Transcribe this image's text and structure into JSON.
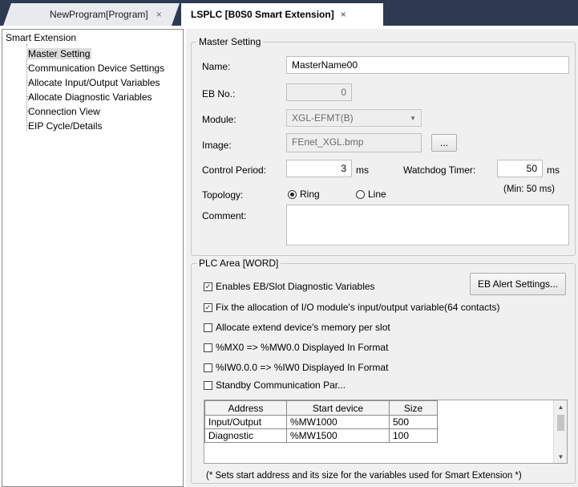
{
  "tabs": [
    {
      "label": "NewProgram[Program]",
      "close": "×"
    },
    {
      "label": "LSPLC [B0S0 Smart Extension]",
      "close": "×"
    }
  ],
  "tree": {
    "root": "Smart Extension",
    "items": [
      "Master Setting",
      "Communication Device Settings",
      "Allocate Input/Output Variables",
      "Allocate Diagnostic Variables",
      "Connection View",
      "EIP Cycle/Details"
    ]
  },
  "master": {
    "legend": "Master Setting",
    "name_label": "Name:",
    "name_value": "MasterName00",
    "eb_label": "EB No.:",
    "eb_value": "0",
    "module_label": "Module:",
    "module_value": "XGL-EFMT(B)",
    "image_label": "Image:",
    "image_value": "FEnet_XGL.bmp",
    "browse_label": "...",
    "control_label": "Control Period:",
    "control_value": "3",
    "control_unit": "ms",
    "watchdog_label": "Watchdog Timer:",
    "watchdog_value": "50",
    "watchdog_unit": "ms",
    "watchdog_min": "(Min: 50 ms)",
    "topology_label": "Topology:",
    "topology_ring": "Ring",
    "topology_line": "Line",
    "topology_selected": "Ring",
    "comment_label": "Comment:",
    "comment_value": ""
  },
  "plc": {
    "legend": "PLC Area [WORD]",
    "alert_button": "EB Alert Settings...",
    "checks": [
      {
        "label": "Enables EB/Slot Diagnostic Variables",
        "checked": true
      },
      {
        "label": "Fix the allocation of I/O module's input/output variable(64 contacts)",
        "checked": true
      },
      {
        "label": "Allocate extend device's memory per slot",
        "checked": false
      },
      {
        "label": "%MX0 => %MW0.0 Displayed In Format",
        "checked": false
      },
      {
        "label": "%IW0.0.0 => %IW0 Displayed In Format",
        "checked": false
      },
      {
        "label": "Standby Communication Par...",
        "checked": false
      }
    ],
    "table": {
      "headers": [
        "Address",
        "Start device",
        "Size"
      ],
      "rows": [
        [
          "Input/Output",
          "%MW1000",
          "500"
        ],
        [
          "Diagnostic",
          "%MW1500",
          "100"
        ]
      ]
    },
    "footnote": "(* Sets start address and its size for the variables used for Smart Extension *)"
  }
}
